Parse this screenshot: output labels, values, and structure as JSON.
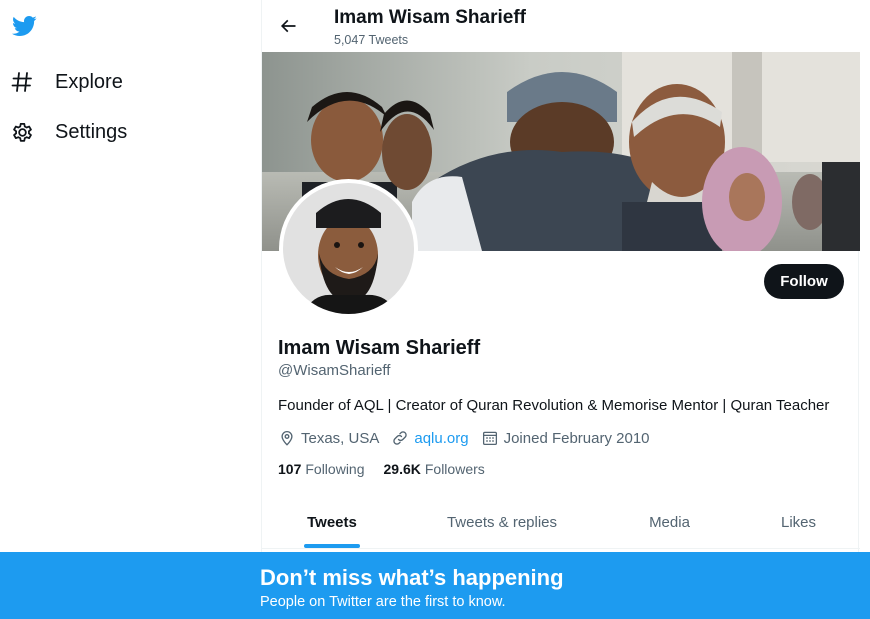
{
  "nav": {
    "logo_icon": "twitter-bird-icon",
    "items": [
      {
        "label": "Explore",
        "icon": "hashtag-icon"
      },
      {
        "label": "Settings",
        "icon": "gear-icon"
      }
    ]
  },
  "header": {
    "name": "Imam Wisam Sharieff",
    "tweet_count": "5,047 Tweets"
  },
  "profile": {
    "display_name": "Imam Wisam Sharieff",
    "handle": "@WisamSharieff",
    "bio": "Founder of AQL | Creator of Quran Revolution & Memorise Mentor | Quran Teacher",
    "location": "Texas, USA",
    "website": "aqlu.org",
    "joined": "Joined February 2010",
    "follow_label": "Follow",
    "following_count": "107",
    "following_label": "Following",
    "followers_count": "29.6K",
    "followers_label": "Followers"
  },
  "tabs": [
    {
      "label": "Tweets",
      "active": true
    },
    {
      "label": "Tweets & replies",
      "active": false
    },
    {
      "label": "Media",
      "active": false
    },
    {
      "label": "Likes",
      "active": false
    }
  ],
  "bottom_bar": {
    "title": "Don’t miss what’s happening",
    "subtitle": "People on Twitter are the first to know."
  },
  "colors": {
    "brand": "#1d9bf0",
    "text": "#0f1419",
    "secondary_text": "#536471",
    "follow_button": "#0f1419"
  }
}
